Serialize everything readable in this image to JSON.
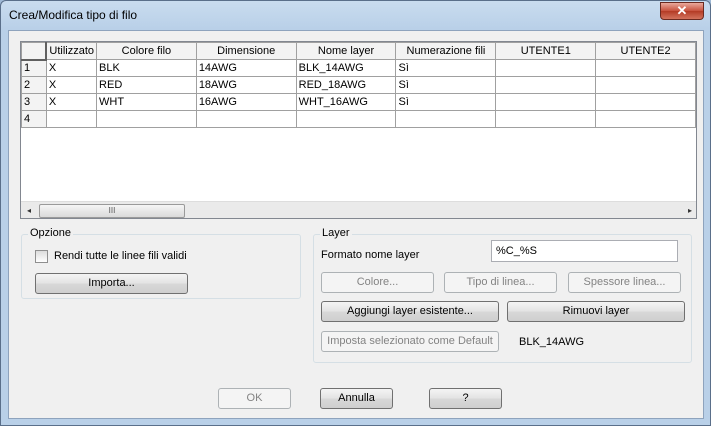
{
  "window": {
    "title": "Crea/Modifica tipo di filo",
    "close_glyph": "✕"
  },
  "grid": {
    "columns": [
      "Utilizzato",
      "Colore filo",
      "Dimensione",
      "Nome layer",
      "Numerazione fili",
      "UTENTE1",
      "UTENTE2"
    ],
    "rows": [
      {
        "num": "1",
        "cells": [
          "X",
          "BLK",
          "14AWG",
          "BLK_14AWG",
          "Sì",
          "",
          ""
        ]
      },
      {
        "num": "2",
        "cells": [
          "X",
          "RED",
          "18AWG",
          "RED_18AWG",
          "Sì",
          "",
          ""
        ]
      },
      {
        "num": "3",
        "cells": [
          "X",
          "WHT",
          "16AWG",
          "WHT_16AWG",
          "Sì",
          "",
          ""
        ]
      },
      {
        "num": "4",
        "cells": [
          "",
          "",
          "",
          "",
          "",
          "",
          ""
        ]
      }
    ],
    "scroll_left": "◂",
    "scroll_right": "▸",
    "thumb_grip": "III"
  },
  "opzione": {
    "title": "Opzione",
    "checkbox_label": "Rendi tutte le linee fili validi",
    "checkbox_checked": false,
    "import_button": "Importa..."
  },
  "layer": {
    "title": "Layer",
    "format_label": "Formato nome layer",
    "format_value": "%C_%S",
    "color_button": "Colore...",
    "linetype_button": "Tipo di linea...",
    "lineweight_button": "Spessore linea...",
    "add_existing_button": "Aggiungi layer esistente...",
    "remove_button": "Rimuovi layer",
    "set_default_button": "Imposta selezionato come Default",
    "default_value": "BLK_14AWG"
  },
  "footer": {
    "ok": "OK",
    "cancel": "Annulla",
    "help": "?"
  }
}
